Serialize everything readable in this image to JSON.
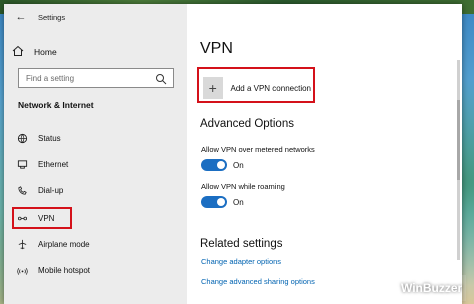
{
  "window": {
    "title": "Settings",
    "controls": [
      "—",
      "☐",
      "✕"
    ]
  },
  "sidebar": {
    "home_label": "Home",
    "search_placeholder": "Find a setting",
    "section_label": "Network & Internet",
    "items": [
      {
        "label": "Status",
        "icon": "globe-icon"
      },
      {
        "label": "Ethernet",
        "icon": "ethernet-icon"
      },
      {
        "label": "Dial-up",
        "icon": "phone-icon"
      },
      {
        "label": "VPN",
        "icon": "vpn-icon",
        "selected": true
      },
      {
        "label": "Airplane mode",
        "icon": "airplane-icon"
      },
      {
        "label": "Mobile hotspot",
        "icon": "hotspot-icon"
      }
    ]
  },
  "main": {
    "title": "VPN",
    "add_connection_label": "Add a VPN connection",
    "advanced_title": "Advanced Options",
    "options": [
      {
        "label": "Allow VPN over metered networks",
        "state": "On"
      },
      {
        "label": "Allow VPN while roaming",
        "state": "On"
      }
    ],
    "related_title": "Related settings",
    "links": [
      "Change adapter options",
      "Change advanced sharing options"
    ]
  },
  "watermark": {
    "text": "WinBuzzer"
  },
  "colors": {
    "accent": "#1b6ec2",
    "highlight": "#d4111a",
    "link": "#0063b1"
  }
}
